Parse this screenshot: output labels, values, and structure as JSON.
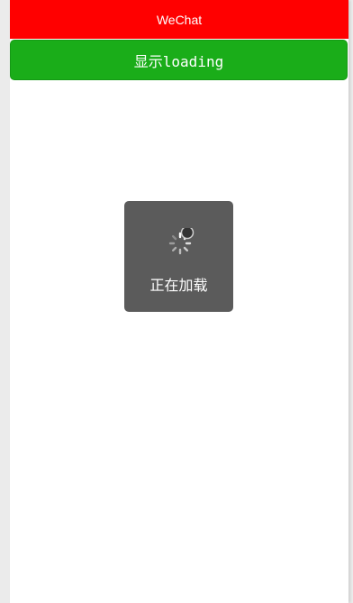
{
  "navbar": {
    "title": "WeChat"
  },
  "button": {
    "label": "显示loading"
  },
  "toast": {
    "text": "正在加载",
    "icon": "loading-spinner-icon"
  },
  "colors": {
    "navbar_bg": "#ff0000",
    "button_bg": "#1aad19",
    "toast_bg": "#5b5b5b"
  }
}
